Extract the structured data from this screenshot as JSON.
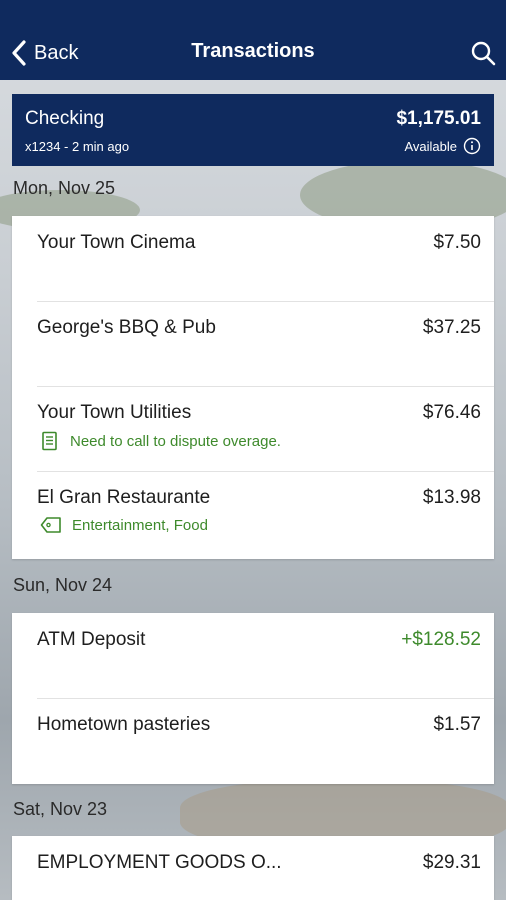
{
  "nav": {
    "back_label": "Back",
    "title": "Transactions"
  },
  "account": {
    "name": "Checking",
    "sub": "x1234 - 2 min ago",
    "balance": "$1,175.01",
    "balance_label": "Available"
  },
  "groups": [
    {
      "date": "Mon, Nov 25",
      "transactions": [
        {
          "merchant": "Your Town Cinema",
          "amount": "$7.50"
        },
        {
          "merchant": "George's BBQ & Pub",
          "amount": "$37.25"
        },
        {
          "merchant": "Your Town Utilities",
          "amount": "$76.46",
          "note": "Need to call to dispute overage."
        },
        {
          "merchant": "El Gran Restaurante",
          "amount": "$13.98",
          "tags": "Entertainment, Food"
        }
      ]
    },
    {
      "date": "Sun, Nov 24",
      "transactions": [
        {
          "merchant": "ATM Deposit",
          "amount": "+$128.52"
        },
        {
          "merchant": "Hometown pasteries",
          "amount": "$1.57"
        }
      ]
    },
    {
      "date": "Sat, Nov 23",
      "transactions": [
        {
          "merchant": "EMPLOYMENT GOODS O...",
          "amount": "$29.31"
        }
      ]
    }
  ],
  "colors": {
    "navy": "#0f2a5e",
    "credit_green": "#3e8a2c"
  },
  "icons": [
    "chevron-left-icon",
    "search-icon",
    "info-icon",
    "memo-icon",
    "tag-icon"
  ]
}
